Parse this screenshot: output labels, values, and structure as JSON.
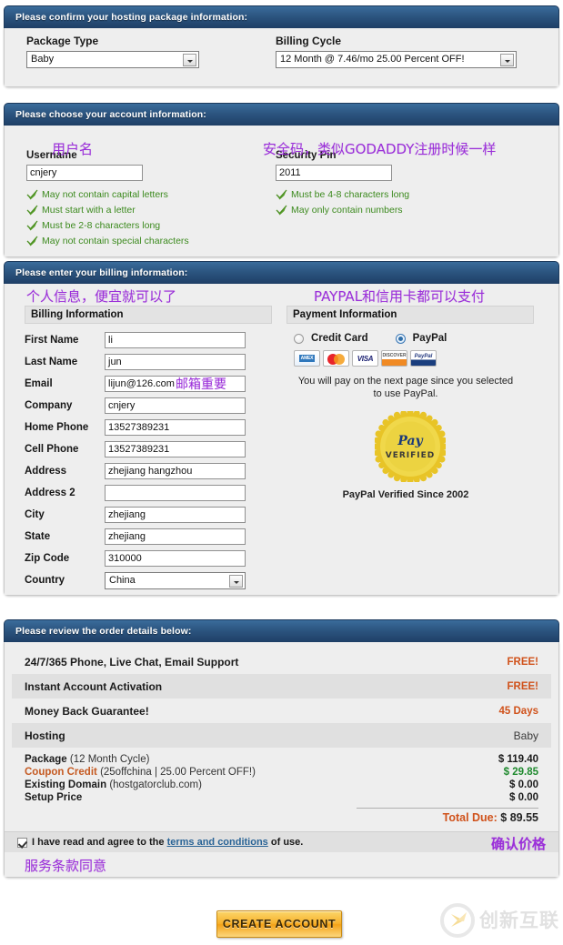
{
  "package_panel": {
    "header": "Please confirm your hosting package information:",
    "package_type_label": "Package Type",
    "package_type_value": "Baby",
    "billing_cycle_label": "Billing Cycle",
    "billing_cycle_value": "12 Month @ 7.46/mo 25.00 Percent OFF!"
  },
  "account_panel": {
    "header": "Please choose your account information:",
    "username_label": "Username",
    "username_value": "cnjery",
    "username_rules": [
      "May not contain capital letters",
      "Must start with a letter",
      "Must be 2-8 characters long",
      "May not contain special characters"
    ],
    "pin_label": "Security Pin",
    "pin_value": "2011",
    "pin_rules": [
      "Must be 4-8 characters long",
      "May only contain numbers"
    ],
    "annotation_username": "用户名",
    "annotation_pin": "安全码，类似GODADDY注册时候一样"
  },
  "billing_panel": {
    "header": "Please enter your billing information:",
    "annotation_billing": "个人信息，便宜就可以了",
    "annotation_payment": "PAYPAL和信用卡都可以支付",
    "annotation_email": "邮箱重要",
    "billing_subhead": "Billing Information",
    "payment_subhead": "Payment Information",
    "fields": [
      {
        "label": "First Name",
        "value": "li",
        "type": "text"
      },
      {
        "label": "Last Name",
        "value": "jun",
        "type": "text"
      },
      {
        "label": "Email",
        "value": "lijun@126.com",
        "type": "text"
      },
      {
        "label": "Company",
        "value": "cnjery",
        "type": "text"
      },
      {
        "label": "Home Phone",
        "value": "13527389231",
        "type": "text"
      },
      {
        "label": "Cell Phone",
        "value": "13527389231",
        "type": "text"
      },
      {
        "label": "Address",
        "value": "zhejiang hangzhou",
        "type": "text"
      },
      {
        "label": "Address 2",
        "value": "",
        "type": "text"
      },
      {
        "label": "City",
        "value": "zhejiang",
        "type": "text"
      },
      {
        "label": "State",
        "value": "zhejiang",
        "type": "text"
      },
      {
        "label": "Zip Code",
        "value": "310000",
        "type": "text"
      },
      {
        "label": "Country",
        "value": "China",
        "type": "select"
      }
    ],
    "payment": {
      "credit_card_label": "Credit Card",
      "paypal_label": "PayPal",
      "selected": "PayPal",
      "card_logos": [
        "amex-card-icon",
        "mastercard-card-icon",
        "visa-card-icon",
        "discover-card-icon",
        "paypal-card-icon"
      ],
      "notice_line1": "You will pay on the next page since you selected",
      "notice_line2": "to use PayPal.",
      "seal_brand": "PayPal",
      "seal_sub": "VERIFIED",
      "seal_caption": "PayPal Verified Since 2002"
    }
  },
  "order_panel": {
    "header": "Please review the order details below:",
    "feature_rows": [
      {
        "name": "24/7/365 Phone, Live Chat, Email Support",
        "value": "FREE!",
        "style": "free"
      },
      {
        "name": "Instant Account Activation",
        "value": "FREE!",
        "style": "free"
      },
      {
        "name": "Money Back Guarantee!",
        "value": "45 Days",
        "style": "days"
      },
      {
        "name": "Hosting",
        "value": "Baby",
        "style": "plan"
      }
    ],
    "line_items": [
      {
        "name": "Package",
        "detail": "(12 Month Cycle)",
        "amount": "$ 119.40",
        "color": "dark"
      },
      {
        "name": "Coupon Credit",
        "detail": "(25offchina | 25.00 Percent OFF!)",
        "amount": "$ 29.85",
        "color": "green"
      },
      {
        "name": "Existing Domain",
        "detail": "(hostgatorclub.com)",
        "amount": "$ 0.00",
        "color": "dark"
      },
      {
        "name": "Setup Price",
        "detail": "",
        "amount": "$ 0.00",
        "color": "dark"
      }
    ],
    "total_label": "Total Due:",
    "total_value": "$ 89.55",
    "agree_pre": "I have read and agree to the",
    "agree_link": "terms and conditions",
    "agree_post": "of use.",
    "annotation_price": "确认价格",
    "annotation_terms": "服务条款同意"
  },
  "footer": {
    "create_account_label": "CREATE ACCOUNT",
    "watermark_text": "创新互联"
  },
  "colors": {
    "header_blue": "#2c5580",
    "panel_bg": "#eeeeee",
    "annotation_purple": "#9b30d9",
    "accent_orange": "#d0521b",
    "green": "#3c8a1e",
    "link_blue": "#2a6496",
    "cta_orange": "#f3a117"
  }
}
